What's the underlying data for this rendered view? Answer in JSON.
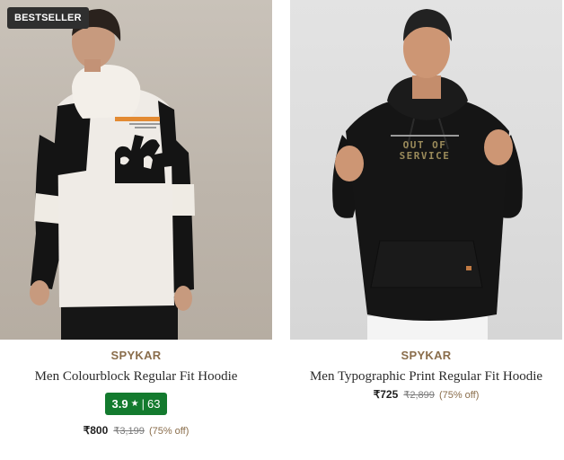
{
  "products": [
    {
      "badge": "BESTSELLER",
      "image_alt": "Man wearing white and black colourblock hoodie, back view",
      "brand": "SPYKAR",
      "title": "Men Colourblock Regular Fit Hoodie",
      "rating": {
        "value": "3.9",
        "star": "★",
        "separator": "|",
        "count": "63"
      },
      "price": "₹800",
      "mrp": "₹3,199",
      "discount": "(75% off)"
    },
    {
      "image_alt": "Man wearing black typographic print hoodie, front view",
      "brand": "SPYKAR",
      "title": "Men Typographic Print Regular Fit Hoodie",
      "print_text": [
        "OUT OF",
        "SERVICE"
      ],
      "price": "₹725",
      "mrp": "₹2,899",
      "discount": "(75% off)"
    }
  ],
  "colors": {
    "brand_text": "#8a6d4b",
    "rating_bg": "#137a2e",
    "badge_bg": "#2f2f2f"
  }
}
